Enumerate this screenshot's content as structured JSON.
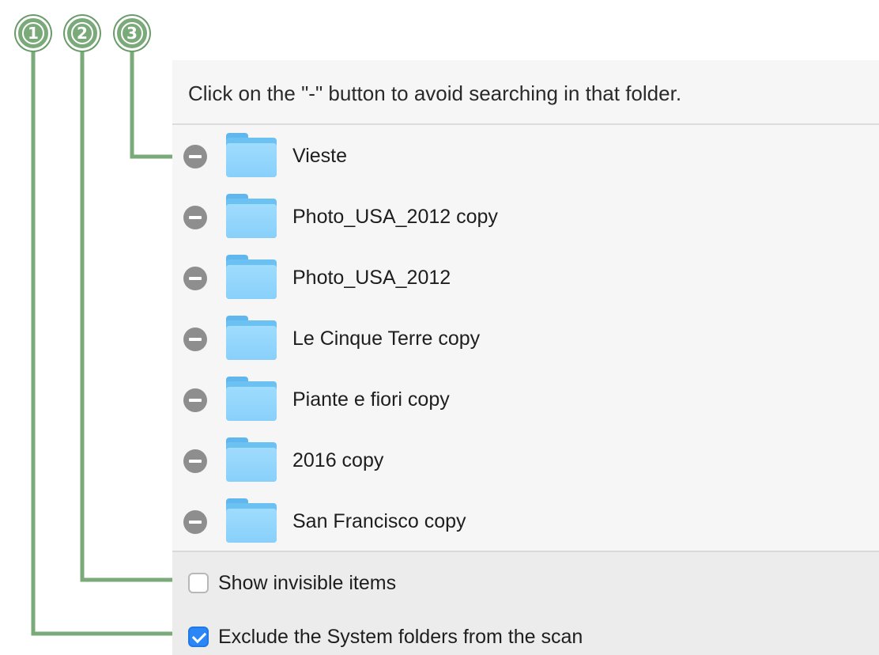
{
  "instruction": "Click on the \"-\" button to avoid searching in that folder.",
  "folders": [
    {
      "name": "Vieste"
    },
    {
      "name": "Photo_USA_2012 copy"
    },
    {
      "name": "Photo_USA_2012"
    },
    {
      "name": "Le Cinque Terre copy"
    },
    {
      "name": "Piante e fiori copy"
    },
    {
      "name": "2016 copy"
    },
    {
      "name": "San Francisco copy"
    }
  ],
  "options": {
    "show_invisible": {
      "label": "Show invisible items",
      "checked": false
    },
    "exclude_system": {
      "label": "Exclude the System folders from the scan",
      "checked": true
    }
  },
  "callouts": [
    {
      "number": "1",
      "target": "exclude-system-checkbox"
    },
    {
      "number": "2",
      "target": "show-invisible-checkbox"
    },
    {
      "number": "3",
      "target": "remove-folder-button"
    }
  ],
  "colors": {
    "callout_green": "#7aa97a",
    "folder_blue": "#88d0fb",
    "checkbox_blue": "#2b86f6",
    "remove_button_gray": "#8e8e8e"
  },
  "icons": {
    "remove": "minus-circle-icon",
    "folder": "folder-icon",
    "check": "checkmark-icon"
  }
}
